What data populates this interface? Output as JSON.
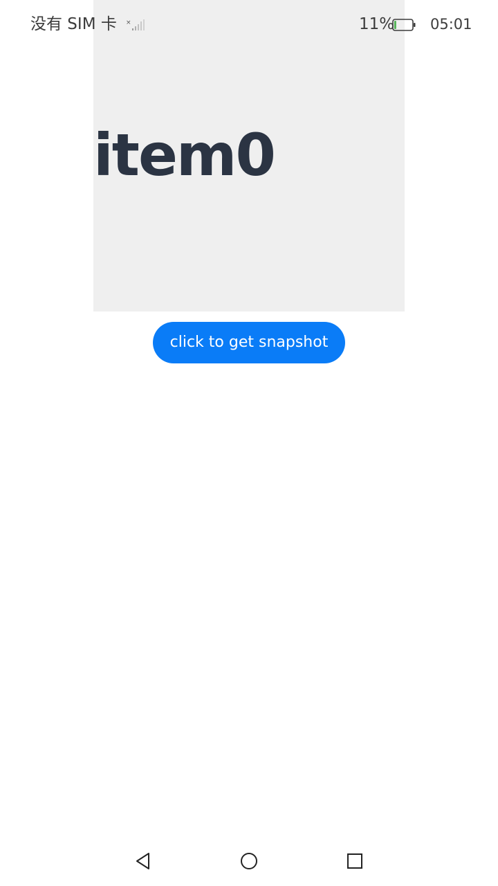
{
  "status_bar": {
    "carrier": "没有 SIM 卡",
    "battery_percent": "11%",
    "time": "05:01",
    "signal_icon": "no-signal-icon",
    "battery_icon": "battery-low-icon",
    "battery_level": 0.11
  },
  "content": {
    "item_label": "item0",
    "snapshot_button_label": "click to get snapshot"
  },
  "nav_bar": {
    "back_icon": "back-triangle-icon",
    "home_icon": "home-circle-icon",
    "recent_icon": "recents-square-icon"
  },
  "colors": {
    "snapshot_bg": "#efefef",
    "item_text": "#2b3443",
    "button_bg": "#0a7cf7",
    "button_text": "#ffffff",
    "battery_fill": "#4caf50"
  }
}
